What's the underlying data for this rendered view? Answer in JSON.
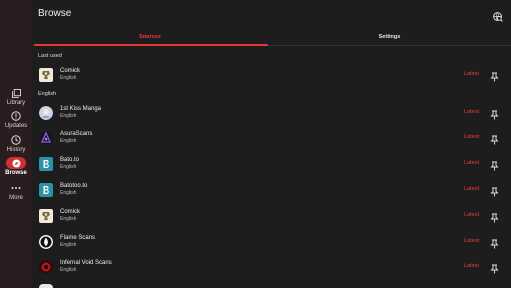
{
  "nav": {
    "items": [
      {
        "label": "Library",
        "icon": "library-icon"
      },
      {
        "label": "Updates",
        "icon": "updates-icon"
      },
      {
        "label": "History",
        "icon": "history-icon"
      },
      {
        "label": "Browse",
        "icon": "compass-icon",
        "active": true
      },
      {
        "label": "More",
        "icon": "more-icon"
      }
    ]
  },
  "appbar": {
    "title": "Browse",
    "action_icon": "global-search-icon"
  },
  "tabs": [
    {
      "label": "Sources",
      "active": true
    },
    {
      "label": "Settings",
      "active": false
    }
  ],
  "sections": {
    "last_used": "Last used",
    "english": "English"
  },
  "last_used": [
    {
      "name": "Comick",
      "lang": "English",
      "action": "Latest"
    }
  ],
  "sources": [
    {
      "name": "1st Kiss Manga",
      "lang": "English",
      "action": "Latest"
    },
    {
      "name": "AsuraScans",
      "lang": "English",
      "action": "Latest"
    },
    {
      "name": "Bato.to",
      "lang": "English",
      "action": "Latest"
    },
    {
      "name": "Batotoo.to",
      "lang": "English",
      "action": "Latest"
    },
    {
      "name": "Comick",
      "lang": "English",
      "action": "Latest"
    },
    {
      "name": "Flame Scans",
      "lang": "English",
      "action": "Latest"
    },
    {
      "name": "Infernal Void Scans",
      "lang": "English",
      "action": "Latest"
    }
  ],
  "colors": {
    "accent": "#ef3b3b",
    "rail": "#2a1c1f",
    "background": "#1e1d1e"
  }
}
